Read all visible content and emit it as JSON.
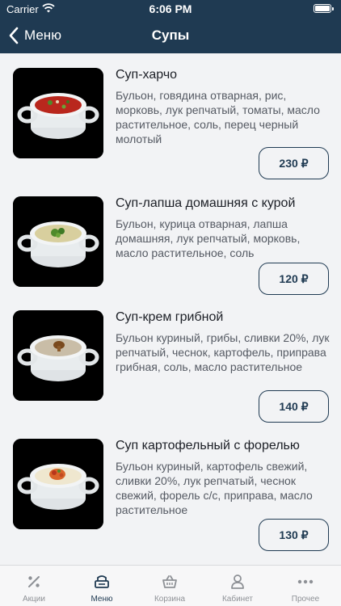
{
  "status": {
    "carrier": "Carrier",
    "time": "6:06 PM"
  },
  "nav": {
    "back_label": "Меню",
    "title": "Супы"
  },
  "items": [
    {
      "name": "Суп-харчо",
      "desc": "Бульон, говядина отварная, рис, морковь, лук репчатый, томаты, масло растительное, соль, перец черный молотый",
      "price": "230 ₽"
    },
    {
      "name": "Суп-лапша домашняя с курой",
      "desc": "Бульон, курица отварная, лапша домашняя, лук репчатый, морковь, масло растительное, соль",
      "price": "120 ₽"
    },
    {
      "name": "Суп-крем грибной",
      "desc": "Бульон куриный, грибы, сливки 20%, лук репчатый, чеснок, картофель, приправа грибная, соль, масло растительное",
      "price": "140 ₽"
    },
    {
      "name": "Суп картофельный с форелью",
      "desc": "Бульон куриный, картофель свежий, сливки 20%, лук репчатый, чеснок свежий, форель с/с, приправа, масло растительное",
      "price": "130 ₽"
    }
  ],
  "tabs": [
    {
      "label": "Акции",
      "icon": "percent-icon"
    },
    {
      "label": "Меню",
      "icon": "menu-icon"
    },
    {
      "label": "Корзина",
      "icon": "basket-icon"
    },
    {
      "label": "Кабинет",
      "icon": "user-icon"
    },
    {
      "label": "Прочее",
      "icon": "more-icon"
    }
  ],
  "colors": {
    "header": "#1f3a52",
    "accent": "#1f3a52",
    "background": "#f2f3f5"
  }
}
